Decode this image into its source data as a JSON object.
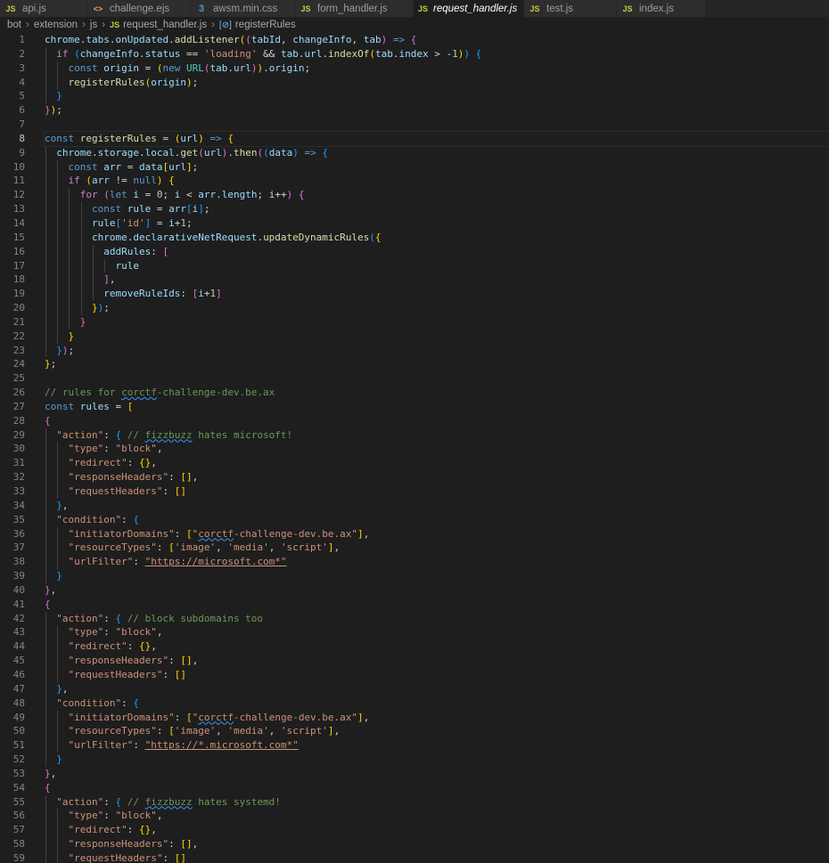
{
  "tabs": [
    {
      "icon": "JS",
      "label": "api.js",
      "active": false
    },
    {
      "icon": "<>",
      "label": "challenge.ejs",
      "active": false
    },
    {
      "icon": "3",
      "label": "awsm.min.css",
      "active": false
    },
    {
      "icon": "JS",
      "label": "form_handler.js",
      "active": false
    },
    {
      "icon": "JS",
      "label": "request_handler.js",
      "active": true
    },
    {
      "icon": "JS",
      "label": "test.js",
      "active": false
    },
    {
      "icon": "JS",
      "label": "index.js",
      "active": false
    }
  ],
  "breadcrumb": {
    "parts": [
      "bot",
      "extension",
      "js"
    ],
    "file_icon": "JS",
    "file": "request_handler.js",
    "symbol_icon": "[⊘]",
    "symbol": "registerRules"
  },
  "editor": {
    "current_line": 8,
    "lines": [
      "chrome.tabs.onUpdated.addListener((tabId, changeInfo, tab) => {",
      "  if (changeInfo.status == 'loading' && tab.url.indexOf(tab.index > -1)) {",
      "    const origin = (new URL(tab.url)).origin;",
      "    registerRules(origin);",
      "  }",
      "});",
      "",
      "const registerRules = (url) => {",
      "  chrome.storage.local.get(url).then((data) => {",
      "    const arr = data[url];",
      "    if (arr != null) {",
      "      for (let i = 0; i < arr.length; i++) {",
      "        const rule = arr[i];",
      "        rule['id'] = i+1;",
      "        chrome.declarativeNetRequest.updateDynamicRules({",
      "          addRules: [",
      "            rule",
      "          ],",
      "          removeRuleIds: [i+1]",
      "        });",
      "      }",
      "    }",
      "  });",
      "};",
      "",
      "// rules for corctf-challenge-dev.be.ax",
      "const rules = [",
      "{",
      "  \"action\": { // fizzbuzz hates microsoft!",
      "    \"type\": \"block\",",
      "    \"redirect\": {},",
      "    \"responseHeaders\": [],",
      "    \"requestHeaders\": []",
      "  },",
      "  \"condition\": {",
      "    \"initiatorDomains\": [\"corctf-challenge-dev.be.ax\"],",
      "    \"resourceTypes\": ['image', 'media', 'script'],",
      "    \"urlFilter\": \"https://microsoft.com*\"",
      "  }",
      "},",
      "{",
      "  \"action\": { // block subdomains too",
      "    \"type\": \"block\",",
      "    \"redirect\": {},",
      "    \"responseHeaders\": [],",
      "    \"requestHeaders\": []",
      "  },",
      "  \"condition\": {",
      "    \"initiatorDomains\": [\"corctf-challenge-dev.be.ax\"],",
      "    \"resourceTypes\": ['image', 'media', 'script'],",
      "    \"urlFilter\": \"https://*.microsoft.com*\"",
      "  }",
      "},",
      "{",
      "  \"action\": { // fizzbuzz hates systemd!",
      "    \"type\": \"block\",",
      "    \"redirect\": {},",
      "    \"responseHeaders\": [],",
      "    \"requestHeaders\": []"
    ]
  }
}
